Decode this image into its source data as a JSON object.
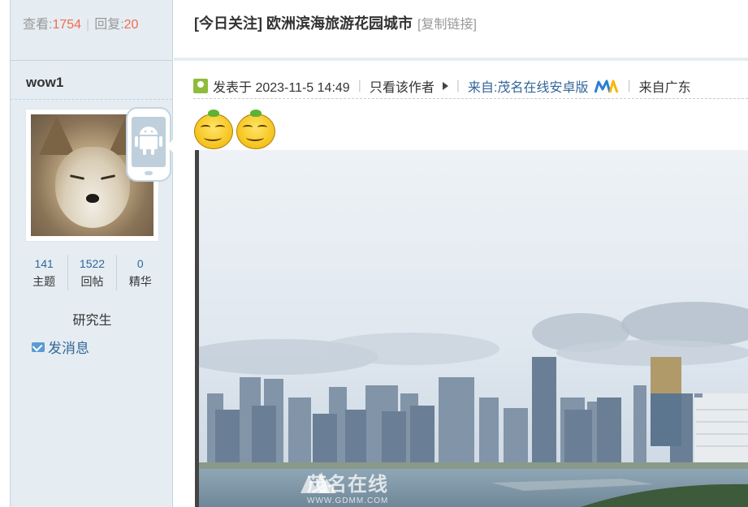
{
  "stats_top": {
    "views_label": "查看:",
    "views": "1754",
    "replies_label": "回复:",
    "replies": "20"
  },
  "thread": {
    "title": "[今日关注] 欧洲滨海旅游花园城市",
    "copy_link": "[复制链接]"
  },
  "author": {
    "name": "wow1",
    "stats": [
      {
        "value": "141",
        "label": "主题"
      },
      {
        "value": "1522",
        "label": "回帖"
      },
      {
        "value": "0",
        "label": "精华"
      }
    ],
    "rank": "研究生",
    "send_message": "发消息"
  },
  "post_meta": {
    "posted": "发表于 2023-11-5 14:49",
    "only_author": "只看该作者",
    "from_app": "来自:茂名在线安卓版",
    "from_region": "来自广东"
  },
  "watermark": {
    "name": "茂名在线",
    "url": "WWW.GDMM.COM"
  },
  "colors": {
    "accent": "#336699",
    "highlight": "#f26c4f",
    "panel": "#e5edf2"
  }
}
